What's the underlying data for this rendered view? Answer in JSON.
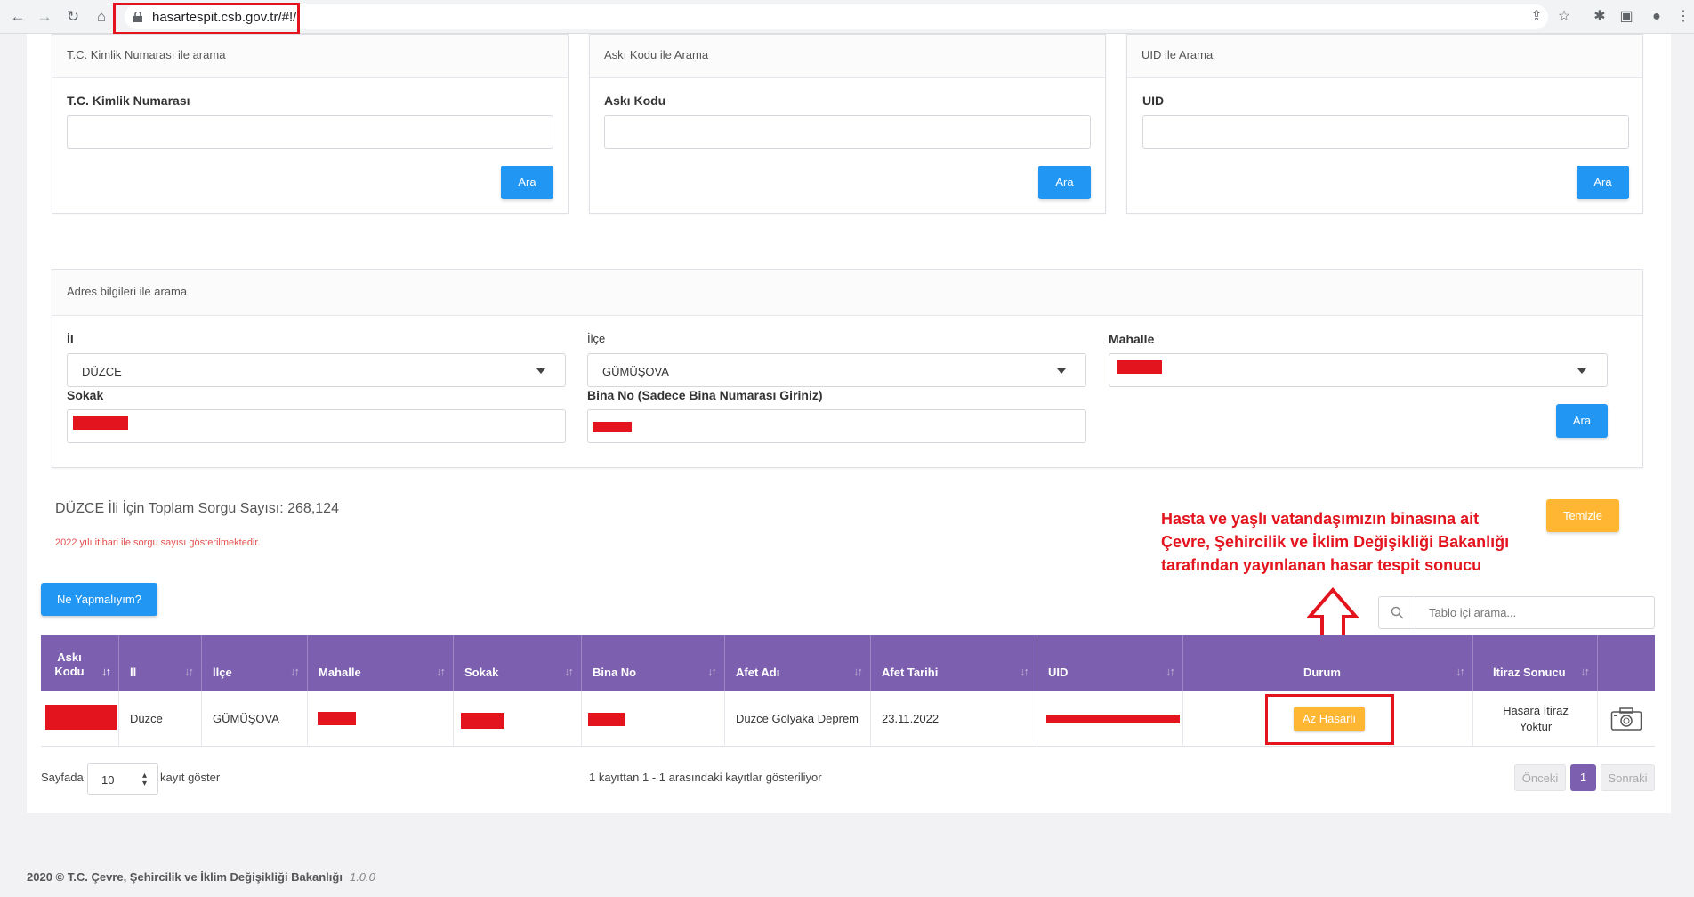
{
  "browser": {
    "url": "hasartespit.csb.gov.tr/#!/"
  },
  "panels": {
    "tc": {
      "header": "T.C. Kimlik Numarası ile arama",
      "label": "T.C. Kimlik Numarası",
      "button": "Ara"
    },
    "aski": {
      "header": "Askı Kodu ile Arama",
      "label": "Askı Kodu",
      "button": "Ara"
    },
    "uid": {
      "header": "UID ile Arama",
      "label": "UID",
      "button": "Ara"
    }
  },
  "address": {
    "header": "Adres bilgileri ile arama",
    "il_label": "İl",
    "il_value": "DÜZCE",
    "ilce_label": "İlçe",
    "ilce_value": "GÜMÜŞOVA",
    "mahalle_label": "Mahalle",
    "sokak_label": "Sokak",
    "bina_label": "Bina No (Sadece Bina Numarası Giriniz)",
    "button": "Ara"
  },
  "summary": {
    "total": "DÜZCE İli İçin Toplam Sorgu Sayısı: 268,124",
    "note": "2022 yılı itibari ile sorgu sayısı gösterilmektedir.",
    "clear_button": "Temizle",
    "help_button": "Ne Yapmalıyım?",
    "search_placeholder": "Tablo içi arama..."
  },
  "annotation": {
    "line1": "Hasta ve yaşlı vatandaşımızın binasına ait",
    "line2": "Çevre, Şehircilik ve İklim Değişikliği Bakanlığı",
    "line3": "tarafından yayınlanan hasar tespit sonucu"
  },
  "table": {
    "columns": {
      "aski": "Askı Kodu",
      "il": "İl",
      "ilce": "İlçe",
      "mahalle": "Mahalle",
      "sokak": "Sokak",
      "bina": "Bina No",
      "afet_adi": "Afet Adı",
      "afet_tarihi": "Afet Tarihi",
      "uid": "UID",
      "durum": "Durum",
      "itiraz": "İtiraz Sonucu"
    },
    "row": {
      "il": "Düzce",
      "ilce": "GÜMÜŞOVA",
      "afet_adi": "Düzce Gölyaka Deprem",
      "afet_tarihi": "23.11.2022",
      "durum": "Az Hasarlı",
      "itiraz_line1": "Hasara İtiraz",
      "itiraz_line2": "Yoktur"
    }
  },
  "pagination": {
    "prefix": "Sayfada",
    "page_size": "10",
    "suffix": "kayıt göster",
    "info": "1 kayıttan 1 - 1 arasındaki kayıtlar gösteriliyor",
    "prev": "Önceki",
    "current": "1",
    "next": "Sonraki"
  },
  "footer": {
    "text": "2020 © T.C. Çevre, Şehircilik ve İklim Değişikliği Bakanlığı",
    "version": "1.0.0"
  },
  "colors": {
    "primary": "#2196f3",
    "warning": "#ffb733",
    "header_purple": "#7c5fae",
    "highlight_red": "#e3141d"
  }
}
